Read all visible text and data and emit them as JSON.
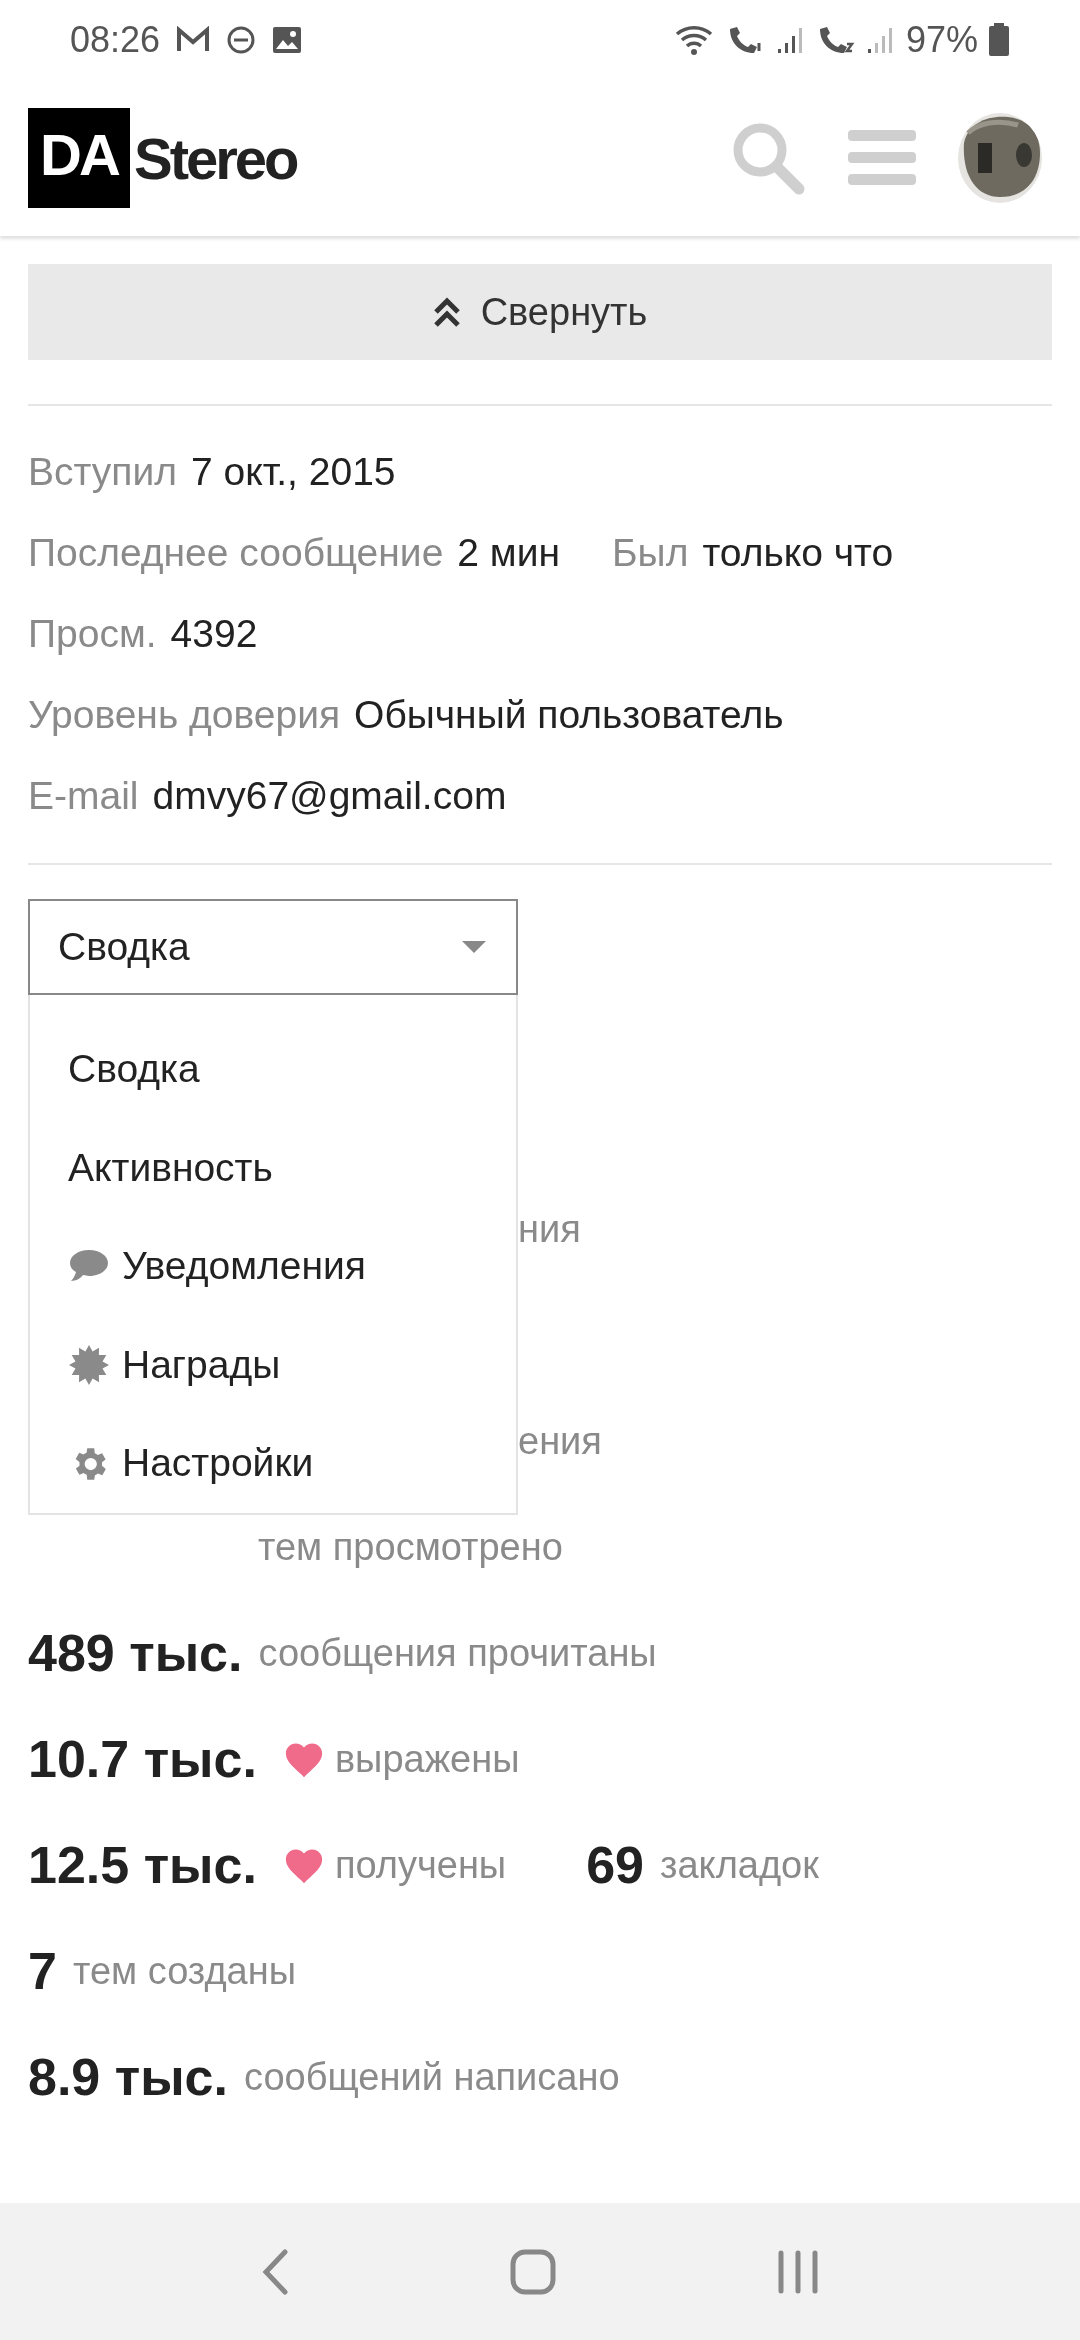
{
  "status_bar": {
    "time": "08:26",
    "battery": "97%"
  },
  "header": {
    "logo": {
      "box": "DA",
      "word": "Stereo"
    }
  },
  "collapse_button": {
    "label": "Свернуть"
  },
  "info": [
    {
      "items": [
        {
          "label": "Вступил",
          "value": "7 окт., 2015"
        }
      ]
    },
    {
      "items": [
        {
          "label": "Последнее сообщение",
          "value": "2 мин"
        },
        {
          "label": "Был",
          "value": "только что"
        }
      ]
    },
    {
      "items": [
        {
          "label": "Просм.",
          "value": "4392"
        }
      ]
    },
    {
      "items": [
        {
          "label": "Уровень доверия",
          "value": "Обычный пользователь"
        }
      ]
    },
    {
      "items": [
        {
          "label": "E-mail",
          "value": "dmvy67@gmail.com"
        }
      ]
    }
  ],
  "select": {
    "value": "Сводка",
    "expanded": true,
    "options": [
      {
        "label": "Сводка",
        "kind": "plain"
      },
      {
        "label": "Активность",
        "kind": "plain"
      },
      {
        "label": "Уведомления",
        "kind": "comment"
      },
      {
        "label": "Награды",
        "kind": "badge"
      },
      {
        "label": "Настройки",
        "kind": "gear"
      }
    ]
  },
  "covered_stats": [
    {
      "fragment": "ния",
      "kind": "right"
    },
    {
      "fragment": "ения",
      "kind": "right"
    },
    {
      "fragment": "тем просмотрено",
      "kind": "left"
    }
  ],
  "stats": [
    {
      "items": [
        {
          "value": "489 тыс.",
          "label": "сообщения прочитаны",
          "heart": false
        }
      ]
    },
    {
      "items": [
        {
          "value": "10.7 тыс.",
          "label": "выражены",
          "heart": true
        }
      ]
    },
    {
      "items": [
        {
          "value": "12.5 тыс.",
          "label": "получены",
          "heart": true
        },
        {
          "value": "69",
          "label": "закладок",
          "heart": false
        }
      ]
    },
    {
      "items": [
        {
          "value": "7",
          "label": "тем созданы",
          "heart": false
        }
      ]
    },
    {
      "items": [
        {
          "value": "8.9 тыс.",
          "label": "сообщений написано",
          "heart": false
        }
      ]
    }
  ]
}
